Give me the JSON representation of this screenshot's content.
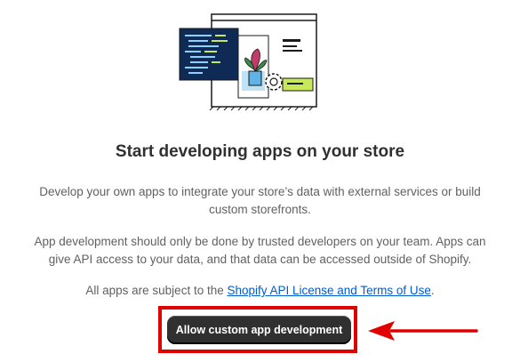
{
  "title": "Start developing apps on your store",
  "paragraphs": {
    "p1_line1": "Develop your own apps to integrate your store’s data with external services or build",
    "p1_line2": "custom storefronts.",
    "p2_line1": "App development should only be done by trusted developers on your team. Apps can",
    "p2_line2": "give API access to your data, and that data can be accessed outside of Shopify.",
    "p3_prefix": "All apps are subject to the ",
    "p3_link": "Shopify API License and Terms of Use",
    "p3_suffix": "."
  },
  "button": {
    "label": "Allow custom app development"
  },
  "colors": {
    "highlight": "#e00000",
    "link": "#005bd3",
    "button": "#303030"
  }
}
